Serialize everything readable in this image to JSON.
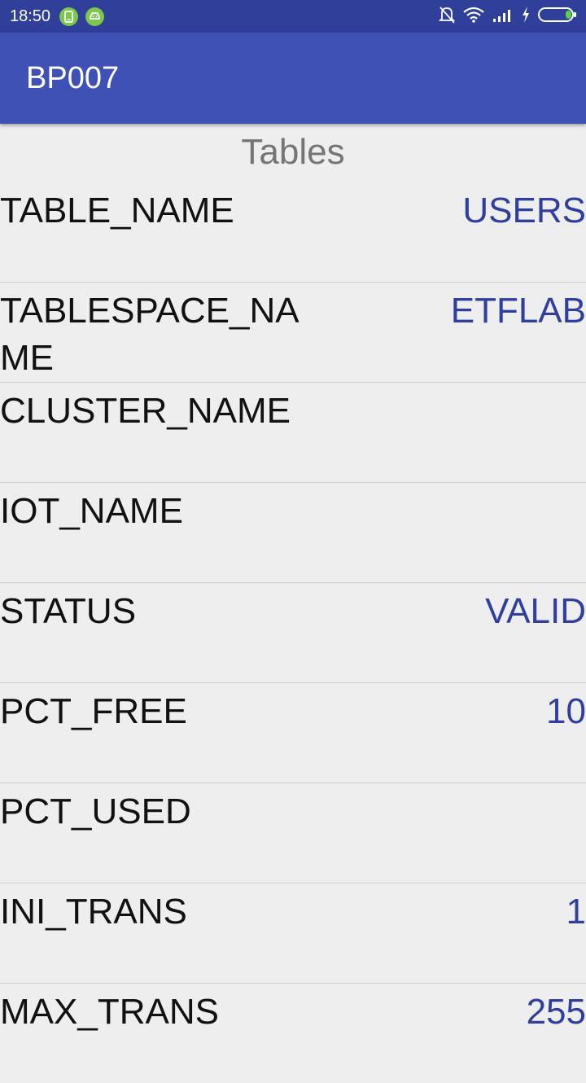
{
  "status_bar": {
    "time": "18:50",
    "icons": [
      "phone-notification-icon",
      "android-notification-icon",
      "mute-icon",
      "wifi-icon",
      "signal-icon",
      "charging-icon",
      "battery-icon"
    ]
  },
  "app_bar": {
    "title": "BP007"
  },
  "section": {
    "title": "Tables"
  },
  "colors": {
    "status_bar": "#2f3f9a",
    "app_bar": "#3f51b5",
    "value_text": "#303f9f",
    "background": "#eeeeee"
  },
  "rows": [
    {
      "key": "TABLE_NAME",
      "value": "USERS"
    },
    {
      "key": "TABLESPACE_NAME",
      "value": "ETFLAB"
    },
    {
      "key": "CLUSTER_NAME",
      "value": ""
    },
    {
      "key": "IOT_NAME",
      "value": ""
    },
    {
      "key": "STATUS",
      "value": "VALID"
    },
    {
      "key": "PCT_FREE",
      "value": "10"
    },
    {
      "key": "PCT_USED",
      "value": ""
    },
    {
      "key": "INI_TRANS",
      "value": "1"
    },
    {
      "key": "MAX_TRANS",
      "value": "255"
    }
  ]
}
